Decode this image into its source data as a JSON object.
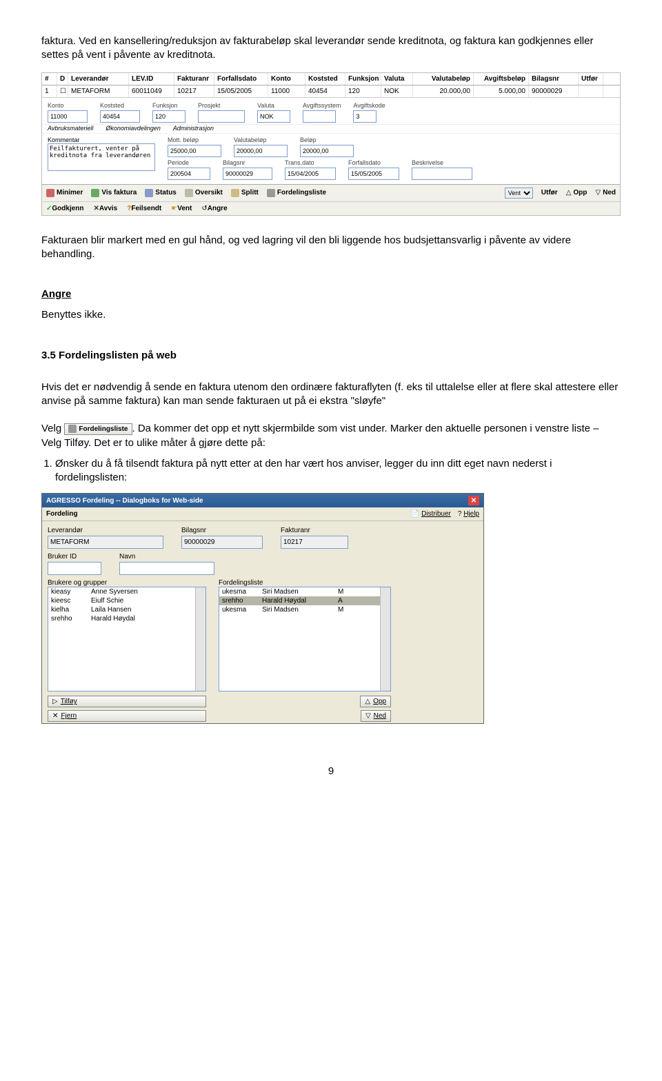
{
  "intro_para": "faktura. Ved en kansellering/reduksjon av fakturabeløp skal leverandør sende kreditnota, og faktura kan godkjennes eller settes på vent i påvente av kreditnota.",
  "shot1": {
    "headers": [
      "#",
      "D",
      "Leverandør",
      "LEV.ID",
      "Fakturanr",
      "Forfallsdato",
      "Konto",
      "Koststed",
      "Funksjon",
      "Valuta",
      "Valutabeløp",
      "Avgiftsbeløp",
      "Bilagsnr",
      "Utfør"
    ],
    "row": [
      "1",
      "☐",
      "METAFORM",
      "60011049",
      "10217",
      "15/05/2005",
      "11000",
      "40454",
      "120",
      "NOK",
      "20.000,00",
      "5.000,00",
      "90000029",
      ""
    ],
    "sub_labels": {
      "konto": "Konto",
      "koststed": "Koststed",
      "funksjon": "Funksjon",
      "prosjekt": "Prosjekt",
      "valuta": "Valuta",
      "avgsys": "Avgiftssystem",
      "avgkode": "Avgiftskode"
    },
    "sub_values": {
      "konto": "11000",
      "koststed": "40454",
      "funksjon": "120",
      "prosjekt": "",
      "valuta": "NOK",
      "avgsys": "",
      "avgkode": "3"
    },
    "sub2_labels": {
      "abruk": "Avbruksmateriell",
      "okavd": "Økonomiavdelingen",
      "adm": "Administrasjon"
    },
    "kommentar_label": "Kommentar",
    "kommentar_value": "Feilfakturert, venter på kreditnota fra leverandøren",
    "mid_labels": {
      "mott": "Mott. beløp",
      "valb": "Valutabeløp",
      "bel": "Beløp",
      "per": "Periode",
      "bil": "Bilagsnr",
      "td": "Trans.dato",
      "ffd": "Forfallsdato",
      "besk": "Beskrivelse"
    },
    "mid_values": {
      "mott": "25000,00",
      "valb": "20000,00",
      "bel": "20000,00",
      "per": "200504",
      "bil": "90000029",
      "td": "15/04/2005",
      "ffd": "15/05/2005",
      "besk": ""
    },
    "toolbar": {
      "minimer": "Minimer",
      "visfaktura": "Vis faktura",
      "status": "Status",
      "oversikt": "Oversikt",
      "splitt": "Splitt",
      "fordel": "Fordelingsliste",
      "vent": "Vent",
      "utfor": "Utfør",
      "opp": "Opp",
      "ned": "Ned"
    },
    "bar2": {
      "godkjenn": "Godkjenn",
      "avvis": "Avvis",
      "feilsendt": "Feilsendt",
      "vent": "Vent",
      "angre": "Angre"
    }
  },
  "para_after_shot1": "Fakturaen blir markert med en gul hånd, og ved lagring vil den bli liggende hos budsjettansvarlig i påvente av videre behandling.",
  "angre_heading": "Angre",
  "angre_text": "Benyttes ikke.",
  "section_heading": "3.5 Fordelingslisten på web",
  "para_fordel": "Hvis det er nødvendig å sende en faktura utenom den ordinære fakturaflyten (f. eks til uttalelse eller at flere skal attestere eller anvise på samme faktura) kan man sende fakturaen ut på ei ekstra \"sløyfe\"",
  "velg_word": "Velg",
  "inline_btn_label": "Fordelingsliste",
  "para_velg_rest": ". Da kommer det opp et nytt skjermbilde som vist under. Marker den aktuelle personen i venstre liste – Velg Tilføy. Det er to ulike måter å gjøre dette på:",
  "list_item_1": "Ønsker du å få tilsendt faktura på nytt etter at den har vært hos anviser, legger du inn ditt eget navn nederst i fordelingslisten:",
  "shot2": {
    "title": "AGRESSO Fordeling -- Dialogboks for Web-side",
    "menu": "Fordeling",
    "distribuer": "Distribuer",
    "hjelp": "Hjelp",
    "lev_label": "Leverandør",
    "lev_value": "METAFORM",
    "bil_label": "Bilagsnr",
    "bil_value": "90000029",
    "fnr_label": "Fakturanr",
    "fnr_value": "10217",
    "brukerid_label": "Bruker ID",
    "navn_label": "Navn",
    "left_title": "Brukere og grupper",
    "right_title": "Fordelingsliste",
    "left_rows": [
      [
        "kieasy",
        "Anne Syversen"
      ],
      [
        "kieesc",
        "Eiulf Schie"
      ],
      [
        "kielha",
        "Laila Hansen"
      ],
      [
        "srehho",
        "Harald Høydal"
      ]
    ],
    "right_rows": [
      [
        "ukesma",
        "Siri Madsen",
        "M"
      ],
      [
        "srehho",
        "Harald Høydal",
        "A"
      ],
      [
        "ukesma",
        "Siri Madsen",
        "M"
      ]
    ],
    "tilfoy": "Tilføy",
    "fjern": "Fjern",
    "opp": "Opp",
    "ned": "Ned"
  },
  "page_number": "9"
}
